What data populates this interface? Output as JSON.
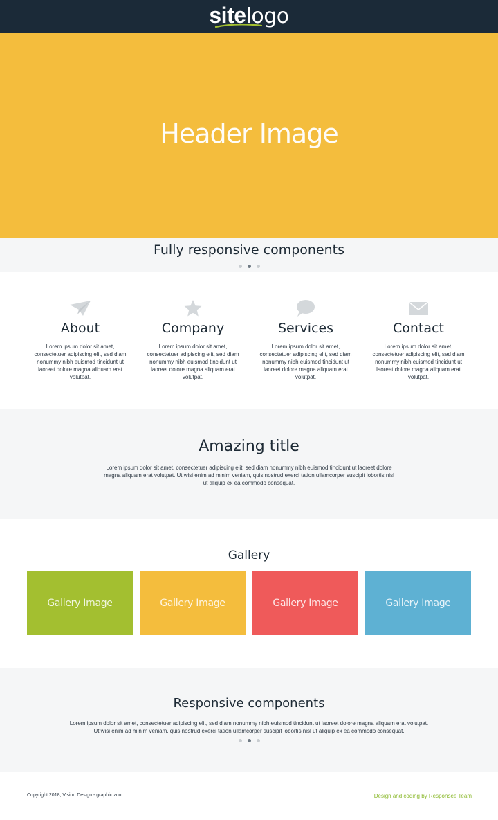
{
  "brand": {
    "logo_bold": "site",
    "logo_light": "logo",
    "accent_color": "#a3bf30"
  },
  "hero": {
    "title": "Header Image",
    "background": "#f4bd3d"
  },
  "slider": {
    "title": "Fully responsive components",
    "active_dot": 2,
    "dot_count": 3
  },
  "features": [
    {
      "icon": "paper-plane-icon",
      "title": "About",
      "text": "Lorem ipsum dolor sit amet, consectetuer adipiscing elit, sed diam nonummy nibh euismod tincidunt ut laoreet dolore magna aliquam erat volutpat."
    },
    {
      "icon": "star-icon",
      "title": "Company",
      "text": "Lorem ipsum dolor sit amet, consectetuer adipiscing elit, sed diam nonummy nibh euismod tincidunt ut laoreet dolore magna aliquam erat volutpat."
    },
    {
      "icon": "chat-bubble-icon",
      "title": "Services",
      "text": "Lorem ipsum dolor sit amet, consectetuer adipiscing elit, sed diam nonummy nibh euismod tincidunt ut laoreet dolore magna aliquam erat volutpat."
    },
    {
      "icon": "envelope-icon",
      "title": "Contact",
      "text": "Lorem ipsum dolor sit amet, consectetuer adipiscing elit, sed diam nonummy nibh euismod tincidunt ut laoreet dolore magna aliquam erat volutpat."
    }
  ],
  "amazing": {
    "title": "Amazing title",
    "text": "Lorem ipsum dolor sit amet, consectetuer adipiscing elit, sed diam nonummy nibh euismod tincidunt ut laoreet dolore magna aliquam erat volutpat. Ut wisi enim ad minim veniam, quis nostrud exerci tation ullamcorper suscipit lobortis nisl ut aliquip ex ea commodo consequat."
  },
  "gallery": {
    "title": "Gallery",
    "images": [
      {
        "label": "Gallery Image",
        "color": "#a3bf30"
      },
      {
        "label": "Gallery Image",
        "color": "#f4bd3d"
      },
      {
        "label": "Gallery Image",
        "color": "#ef5a5a"
      },
      {
        "label": "Gallery Image",
        "color": "#5eb1d3"
      }
    ]
  },
  "responsive": {
    "title": "Responsive components",
    "text": "Lorem ipsum dolor sit amet, consectetuer adipiscing elit, sed diam nonummy nibh euismod tincidunt ut laoreet dolore magna aliquam erat volutpat. Ut wisi enim ad minim veniam, quis nostrud exerci tation ullamcorper suscipit lobortis nisl ut aliquip ex ea commodo consequat.",
    "active_dot": 2,
    "dot_count": 3
  },
  "footer": {
    "copyright": "Copyright 2018, Vision Design - graphic zoo",
    "credit": "Design and coding by Responsee Team",
    "credit_color": "#8bb92d"
  }
}
